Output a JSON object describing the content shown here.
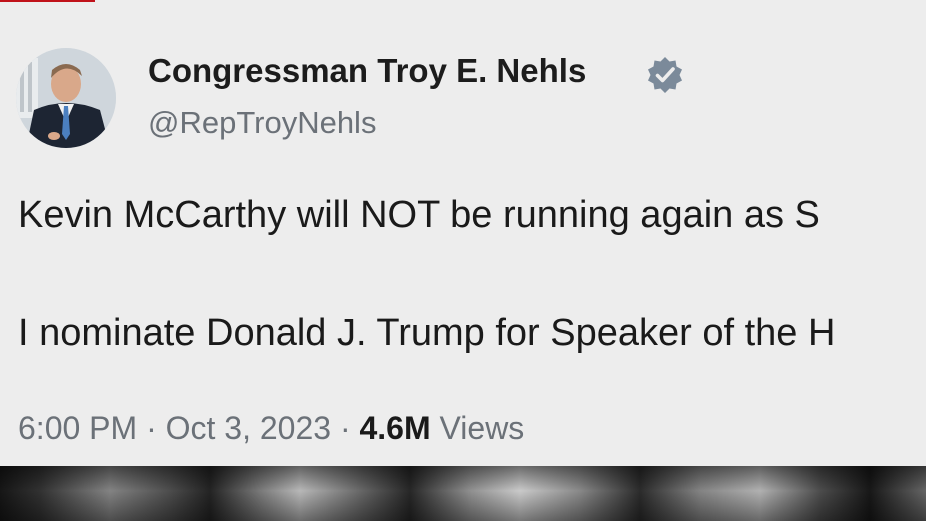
{
  "tweet": {
    "author_name": "Congressman Troy E. Nehls",
    "handle": "@RepTroyNehls",
    "verified_icon": "verified-badge-icon",
    "lines": [
      "Kevin McCarthy will NOT be running again as S",
      "I nominate Donald J. Trump for Speaker of the H"
    ],
    "time": "6:00 PM",
    "separator": "·",
    "date": "Oct 3, 2023",
    "view_count": "4.6M",
    "views_label": "Views"
  },
  "colors": {
    "card_background": "#ededed",
    "name_text": "#1c1c1c",
    "muted_text": "#6b7178",
    "verified_badge": "#7b8a9a",
    "broadcast_accent": "#c0121a"
  }
}
